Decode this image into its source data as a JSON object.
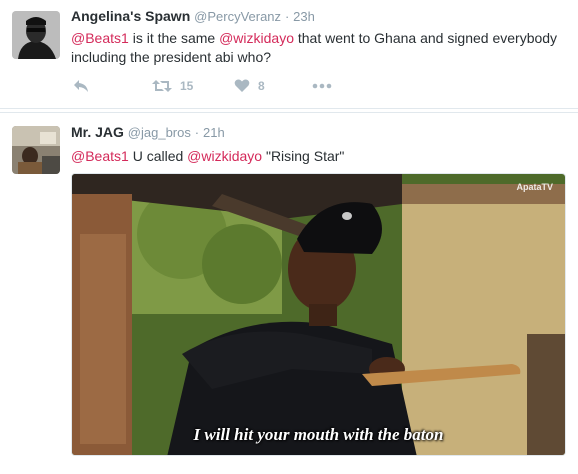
{
  "tweets": [
    {
      "name": "Angelina's Spawn",
      "handle": "@PercyVeranz",
      "separator": "·",
      "time": "23h",
      "text_parts": [
        {
          "type": "mention",
          "text": "@Beats1"
        },
        {
          "type": "text",
          "text": " is it the same "
        },
        {
          "type": "mention",
          "text": "@wizkidayo"
        },
        {
          "type": "text",
          "text": " that went to Ghana and signed everybody including the president abi who?"
        }
      ],
      "actions": {
        "reply_icon": "reply-icon",
        "retweet_icon": "retweet-icon",
        "retweet_count": "15",
        "like_icon": "heart-icon",
        "like_count": "8",
        "more_icon": "more-icon"
      }
    },
    {
      "name": "Mr. JAG",
      "handle": "@jag_bros",
      "separator": "·",
      "time": "21h",
      "text_parts": [
        {
          "type": "mention",
          "text": "@Beats1"
        },
        {
          "type": "text",
          "text": " U called "
        },
        {
          "type": "mention",
          "text": "@wizkidayo"
        },
        {
          "type": "text",
          "text": " \"Rising Star\""
        }
      ],
      "media": {
        "caption": "I will hit your mouth with the baton",
        "watermark": "ApataTV"
      }
    }
  ],
  "colors": {
    "mention": "#d42a5a",
    "meta": "#8899a6",
    "action": "#aab8c2",
    "divider": "#e1e8ed"
  }
}
